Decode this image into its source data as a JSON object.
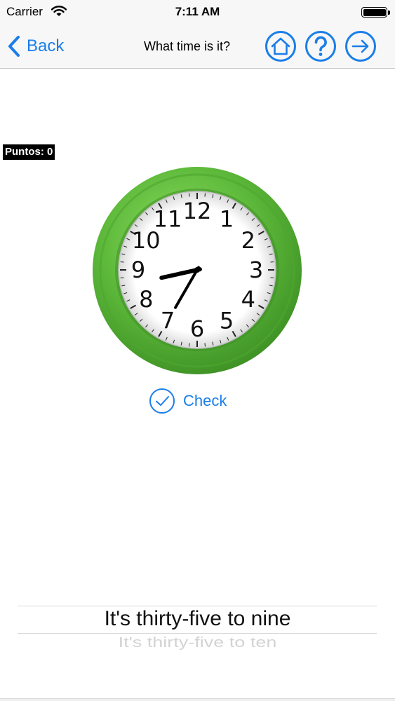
{
  "status_bar": {
    "carrier": "Carrier",
    "time": "7:11 AM"
  },
  "nav": {
    "back_label": "Back",
    "title": "What time is it?",
    "icons": [
      "home-icon",
      "help-icon",
      "arrow-right-icon"
    ]
  },
  "score": {
    "label": "Puntos: 0"
  },
  "clock": {
    "numbers": [
      "12",
      "1",
      "2",
      "3",
      "4",
      "5",
      "6",
      "7",
      "8",
      "9",
      "10",
      "11"
    ],
    "hour": 8,
    "minute": 35,
    "frame_color": "#5cb83a"
  },
  "check": {
    "label": "Check"
  },
  "picker": {
    "selected": "It's thirty-five to nine",
    "next": "It's thirty-five to ten"
  },
  "colors": {
    "accent": "#1a7ee8",
    "background": "#ffffff"
  }
}
